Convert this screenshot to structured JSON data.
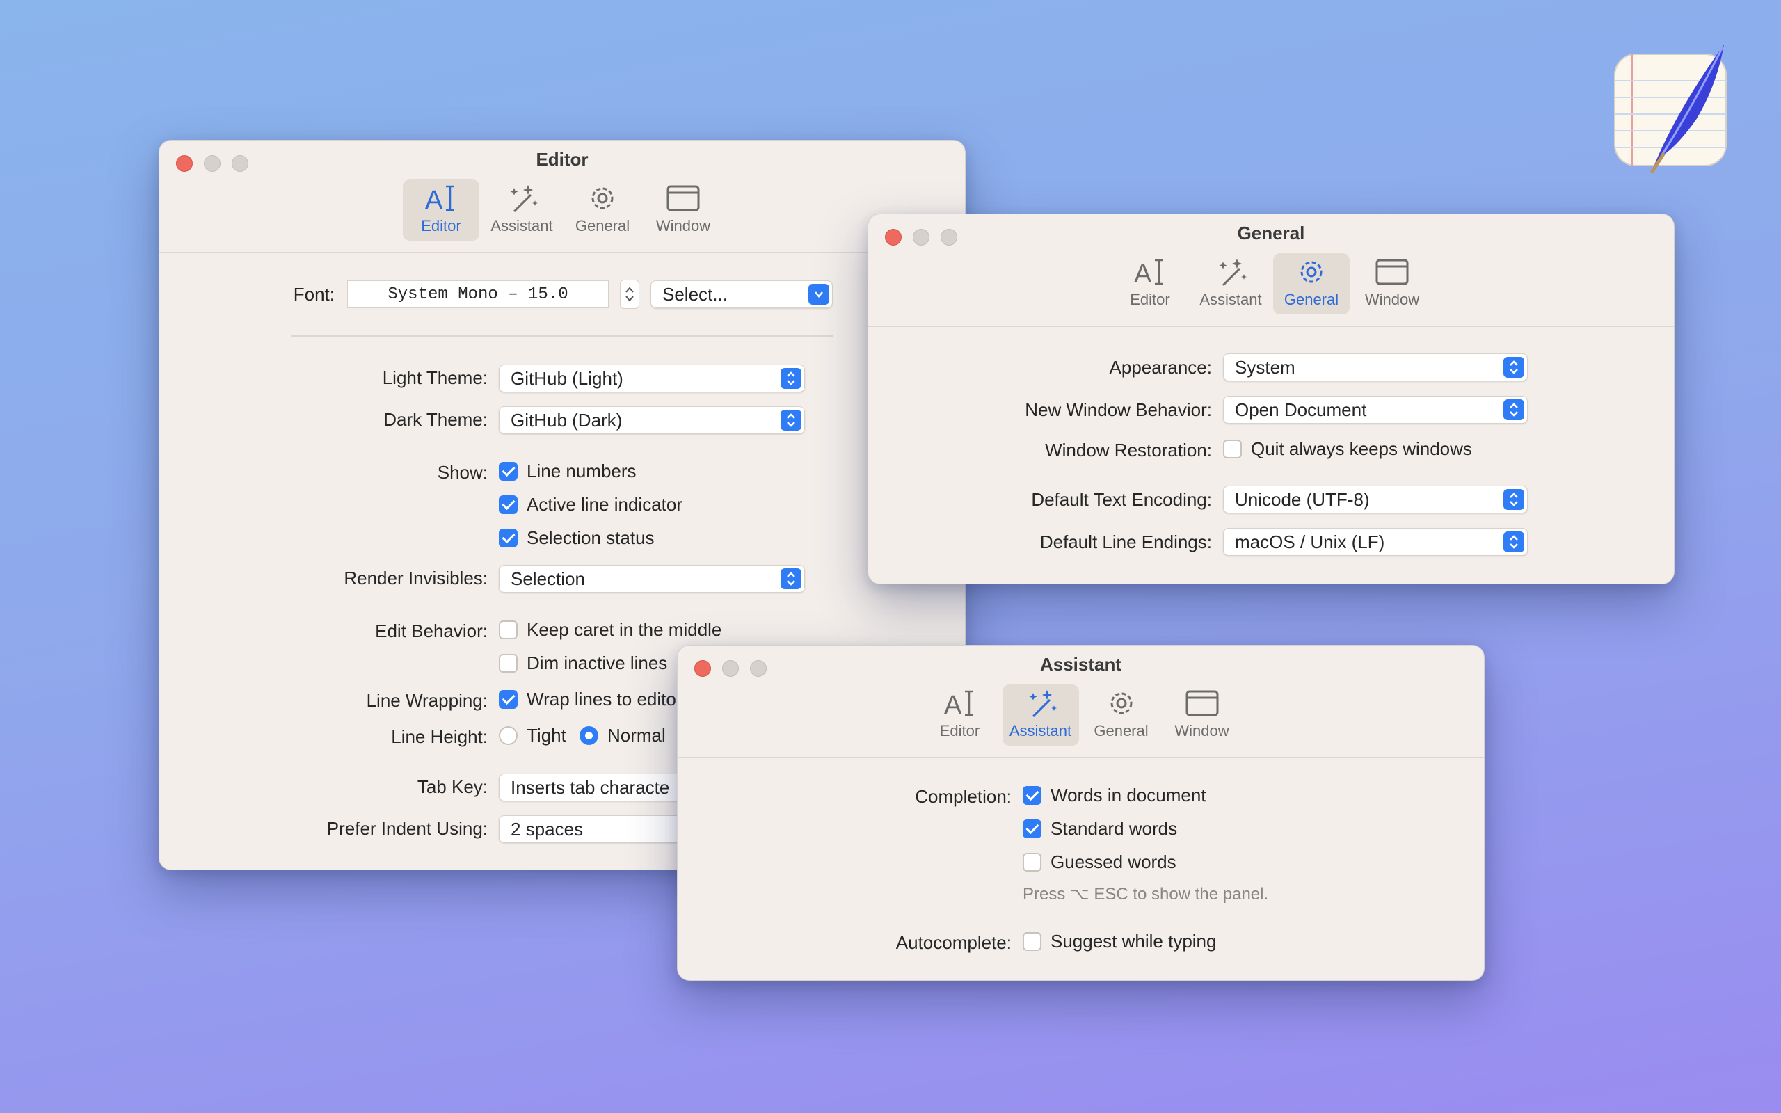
{
  "tab_labels": {
    "editor": "Editor",
    "assistant": "Assistant",
    "general": "General",
    "window": "Window"
  },
  "accent_color": "#2f7df6",
  "editor_window": {
    "title": "Editor",
    "selected_tab": "Editor",
    "font": {
      "label": "Font:",
      "value": "System Mono – 15.0",
      "select_label": "Select..."
    },
    "light_theme": {
      "label": "Light Theme:",
      "value": "GitHub (Light)"
    },
    "dark_theme": {
      "label": "Dark Theme:",
      "value": "GitHub (Dark)"
    },
    "show": {
      "label": "Show:",
      "options": [
        {
          "label": "Line numbers",
          "checked": true
        },
        {
          "label": "Active line indicator",
          "checked": true
        },
        {
          "label": "Selection status",
          "checked": true
        }
      ]
    },
    "render_invisibles": {
      "label": "Render Invisibles:",
      "value": "Selection"
    },
    "edit_behavior": {
      "label": "Edit Behavior:",
      "options": [
        {
          "label": "Keep caret in the middle",
          "checked": false
        },
        {
          "label": "Dim inactive lines",
          "checked": false
        }
      ]
    },
    "line_wrapping": {
      "label": "Line Wrapping:",
      "option": "Wrap lines to edito",
      "checked": true
    },
    "line_height": {
      "label": "Line Height:",
      "options": [
        "Tight",
        "Normal"
      ],
      "selected": "Normal"
    },
    "tab_key": {
      "label": "Tab Key:",
      "value": "Inserts tab characte"
    },
    "prefer_indent": {
      "label": "Prefer Indent Using:",
      "value": "2 spaces"
    }
  },
  "general_window": {
    "title": "General",
    "selected_tab": "General",
    "appearance": {
      "label": "Appearance:",
      "value": "System"
    },
    "new_window_behavior": {
      "label": "New Window Behavior:",
      "value": "Open Document"
    },
    "window_restoration": {
      "label": "Window Restoration:",
      "option": "Quit always keeps windows",
      "checked": false
    },
    "default_text_encoding": {
      "label": "Default Text Encoding:",
      "value": "Unicode (UTF-8)"
    },
    "default_line_endings": {
      "label": "Default Line Endings:",
      "value": "macOS / Unix (LF)"
    }
  },
  "assistant_window": {
    "title": "Assistant",
    "selected_tab": "Assistant",
    "completion": {
      "label": "Completion:",
      "options": [
        {
          "label": "Words in document",
          "checked": true
        },
        {
          "label": "Standard words",
          "checked": true
        },
        {
          "label": "Guessed words",
          "checked": false
        }
      ],
      "hint": "Press ⌥ ESC to show the panel."
    },
    "autocomplete": {
      "label": "Autocomplete:",
      "option": "Suggest while typing",
      "checked": false
    }
  }
}
